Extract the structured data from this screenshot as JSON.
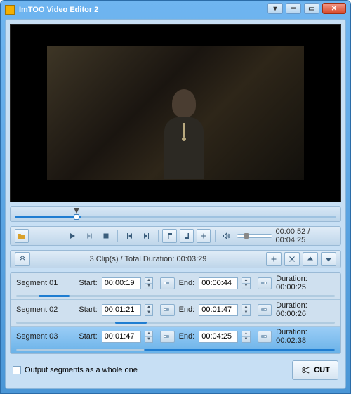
{
  "app": {
    "title": "ImTOO Video Editor 2"
  },
  "playback": {
    "current": "00:00:52",
    "total": "00:04:25",
    "progress_pct": 20,
    "marker_pct": 20
  },
  "clips_summary": {
    "count_label": "3 Clip(s)",
    "separator": " /  ",
    "total_label": "Total Duration:",
    "total_value": "00:03:29"
  },
  "labels": {
    "start": "Start:",
    "end": "End:",
    "duration": "Duration:"
  },
  "segments": [
    {
      "name": "Segment 01",
      "start": "00:00:19",
      "end": "00:00:44",
      "duration": "00:00:25",
      "bar_left_pct": 7,
      "bar_width_pct": 10,
      "selected": false
    },
    {
      "name": "Segment 02",
      "start": "00:01:21",
      "end": "00:01:47",
      "duration": "00:00:26",
      "bar_left_pct": 31,
      "bar_width_pct": 10,
      "selected": false
    },
    {
      "name": "Segment 03",
      "start": "00:01:47",
      "end": "00:04:25",
      "duration": "00:02:38",
      "bar_left_pct": 40,
      "bar_width_pct": 60,
      "selected": true
    }
  ],
  "footer": {
    "output_whole_label": "Output segments as a whole one",
    "cut_label": "CUT"
  }
}
